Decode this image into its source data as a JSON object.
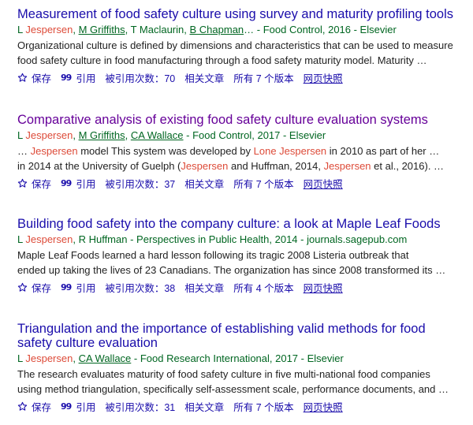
{
  "results": [
    {
      "title": "Measurement of food safety culture using survey and maturity profiling tools",
      "visited": false,
      "authors": [
        {
          "prefix": "L ",
          "name": "Jespersen",
          "sep": ", ",
          "linked": false,
          "hl": true
        },
        {
          "prefix": "",
          "name": "M Griffiths",
          "sep": ", ",
          "linked": true,
          "hl": false
        },
        {
          "prefix": "",
          "name": "T Maclaurin",
          "sep": ", ",
          "linked": false,
          "hl": false
        },
        {
          "prefix": "",
          "name": "B Chapman",
          "sep": "",
          "linked": true,
          "hl": false
        }
      ],
      "source": "… - Food Control, 2016 - Elsevier",
      "snippet_lines": [
        [
          {
            "t": "Organizational culture is defined by dimensions and characteristics that can be used to measure",
            "hl": false
          }
        ],
        [
          {
            "t": "food safety culture in food manufacturing through a food safety maturity model. Maturity …",
            "hl": false
          }
        ]
      ],
      "actions": {
        "save": "保存",
        "cite": "引用",
        "cited_by": "被引用次数：70",
        "related": "相关文章",
        "versions": "所有 7 个版本",
        "cache": "网页快照"
      }
    },
    {
      "title": "Comparative analysis of existing food safety culture evaluation systems",
      "visited": true,
      "authors": [
        {
          "prefix": "L ",
          "name": "Jespersen",
          "sep": ", ",
          "linked": false,
          "hl": true
        },
        {
          "prefix": "",
          "name": "M Griffiths",
          "sep": ", ",
          "linked": true,
          "hl": false
        },
        {
          "prefix": "",
          "name": "CA Wallace",
          "sep": "",
          "linked": true,
          "hl": false
        }
      ],
      "source": " - Food Control, 2017 - Elsevier",
      "snippet_lines": [
        [
          {
            "t": "… ",
            "hl": false
          },
          {
            "t": "Jespersen",
            "hl": true
          },
          {
            "t": " model This system was developed by ",
            "hl": false
          },
          {
            "t": "Lone Jespersen",
            "hl": true
          },
          {
            "t": " in 2010 as part of her …",
            "hl": false
          }
        ],
        [
          {
            "t": "in 2014 at the University of Guelph (",
            "hl": false
          },
          {
            "t": "Jespersen",
            "hl": true
          },
          {
            "t": " and Huffman, 2014, ",
            "hl": false
          },
          {
            "t": "Jespersen",
            "hl": true
          },
          {
            "t": " et al., 2016). …",
            "hl": false
          }
        ]
      ],
      "actions": {
        "save": "保存",
        "cite": "引用",
        "cited_by": "被引用次数：37",
        "related": "相关文章",
        "versions": "所有 7 个版本",
        "cache": "网页快照"
      }
    },
    {
      "title": "Building food safety into the company culture: a look at Maple Leaf Foods",
      "visited": false,
      "authors": [
        {
          "prefix": "L ",
          "name": "Jespersen",
          "sep": ", ",
          "linked": false,
          "hl": true
        },
        {
          "prefix": "",
          "name": "R Huffman",
          "sep": "",
          "linked": false,
          "hl": false
        }
      ],
      "source": " - Perspectives in Public Health, 2014 - journals.sagepub.com",
      "snippet_lines": [
        [
          {
            "t": "Maple Leaf Foods learned a hard lesson following its tragic 2008 Listeria outbreak that",
            "hl": false
          }
        ],
        [
          {
            "t": "ended up taking the lives of 23 Canadians. The organization has since 2008 transformed its …",
            "hl": false
          }
        ]
      ],
      "actions": {
        "save": "保存",
        "cite": "引用",
        "cited_by": "被引用次数：38",
        "related": "相关文章",
        "versions": "所有 4 个版本",
        "cache": "网页快照"
      }
    },
    {
      "title": "Triangulation and the importance of establishing valid methods for food safety culture evaluation",
      "visited": false,
      "authors": [
        {
          "prefix": "L ",
          "name": "Jespersen",
          "sep": ", ",
          "linked": false,
          "hl": true
        },
        {
          "prefix": "",
          "name": "CA Wallace",
          "sep": "",
          "linked": true,
          "hl": false
        }
      ],
      "source": " - Food Research International, 2017 - Elsevier",
      "snippet_lines": [
        [
          {
            "t": "The research evaluates maturity of food safety culture in five multi-national food companies",
            "hl": false
          }
        ],
        [
          {
            "t": "using method triangulation, specifically self-assessment scale, performance documents, and …",
            "hl": false
          }
        ]
      ],
      "actions": {
        "save": "保存",
        "cite": "引用",
        "cited_by": "被引用次数：31",
        "related": "相关文章",
        "versions": "所有 7 个版本",
        "cache": "网页快照"
      }
    }
  ],
  "colors": {
    "link": "#1a0dab",
    "visited": "#660099",
    "meta": "#006621",
    "highlight": "#dd4b39"
  }
}
